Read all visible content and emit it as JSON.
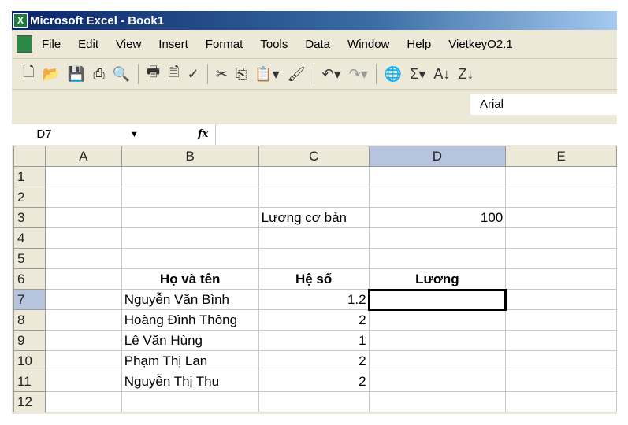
{
  "title": "Microsoft Excel - Book1",
  "menu": [
    "File",
    "Edit",
    "View",
    "Insert",
    "Format",
    "Tools",
    "Data",
    "Window",
    "Help",
    "VietkeyO2.1"
  ],
  "font_name": "Arial",
  "name_box": "D7",
  "fx": "fx",
  "columns": [
    "A",
    "B",
    "C",
    "D",
    "E"
  ],
  "rows": [
    {
      "n": "1",
      "cells": [
        "",
        "",
        "",
        "",
        ""
      ]
    },
    {
      "n": "2",
      "cells": [
        "",
        "",
        "",
        "",
        ""
      ]
    },
    {
      "n": "3",
      "cells": [
        "",
        "",
        "Lương cơ bản",
        "100",
        ""
      ]
    },
    {
      "n": "4",
      "cells": [
        "",
        "",
        "",
        "",
        ""
      ]
    },
    {
      "n": "5",
      "cells": [
        "",
        "",
        "",
        "",
        ""
      ]
    },
    {
      "n": "6",
      "cells": [
        "",
        "Họ và tên",
        "Hệ số",
        "Lương",
        ""
      ]
    },
    {
      "n": "7",
      "cells": [
        "",
        "Nguyễn Văn Bình",
        "1.2",
        "",
        ""
      ]
    },
    {
      "n": "8",
      "cells": [
        "",
        "Hoàng Đình Thông",
        "2",
        "",
        ""
      ]
    },
    {
      "n": "9",
      "cells": [
        "",
        "Lê Văn Hùng",
        "1",
        "",
        ""
      ]
    },
    {
      "n": "10",
      "cells": [
        "",
        "Phạm Thị Lan",
        "2",
        "",
        ""
      ]
    },
    {
      "n": "11",
      "cells": [
        "",
        "Nguyễn Thị Thu",
        "2",
        "",
        ""
      ]
    },
    {
      "n": "12",
      "cells": [
        "",
        "",
        "",
        "",
        ""
      ]
    }
  ]
}
